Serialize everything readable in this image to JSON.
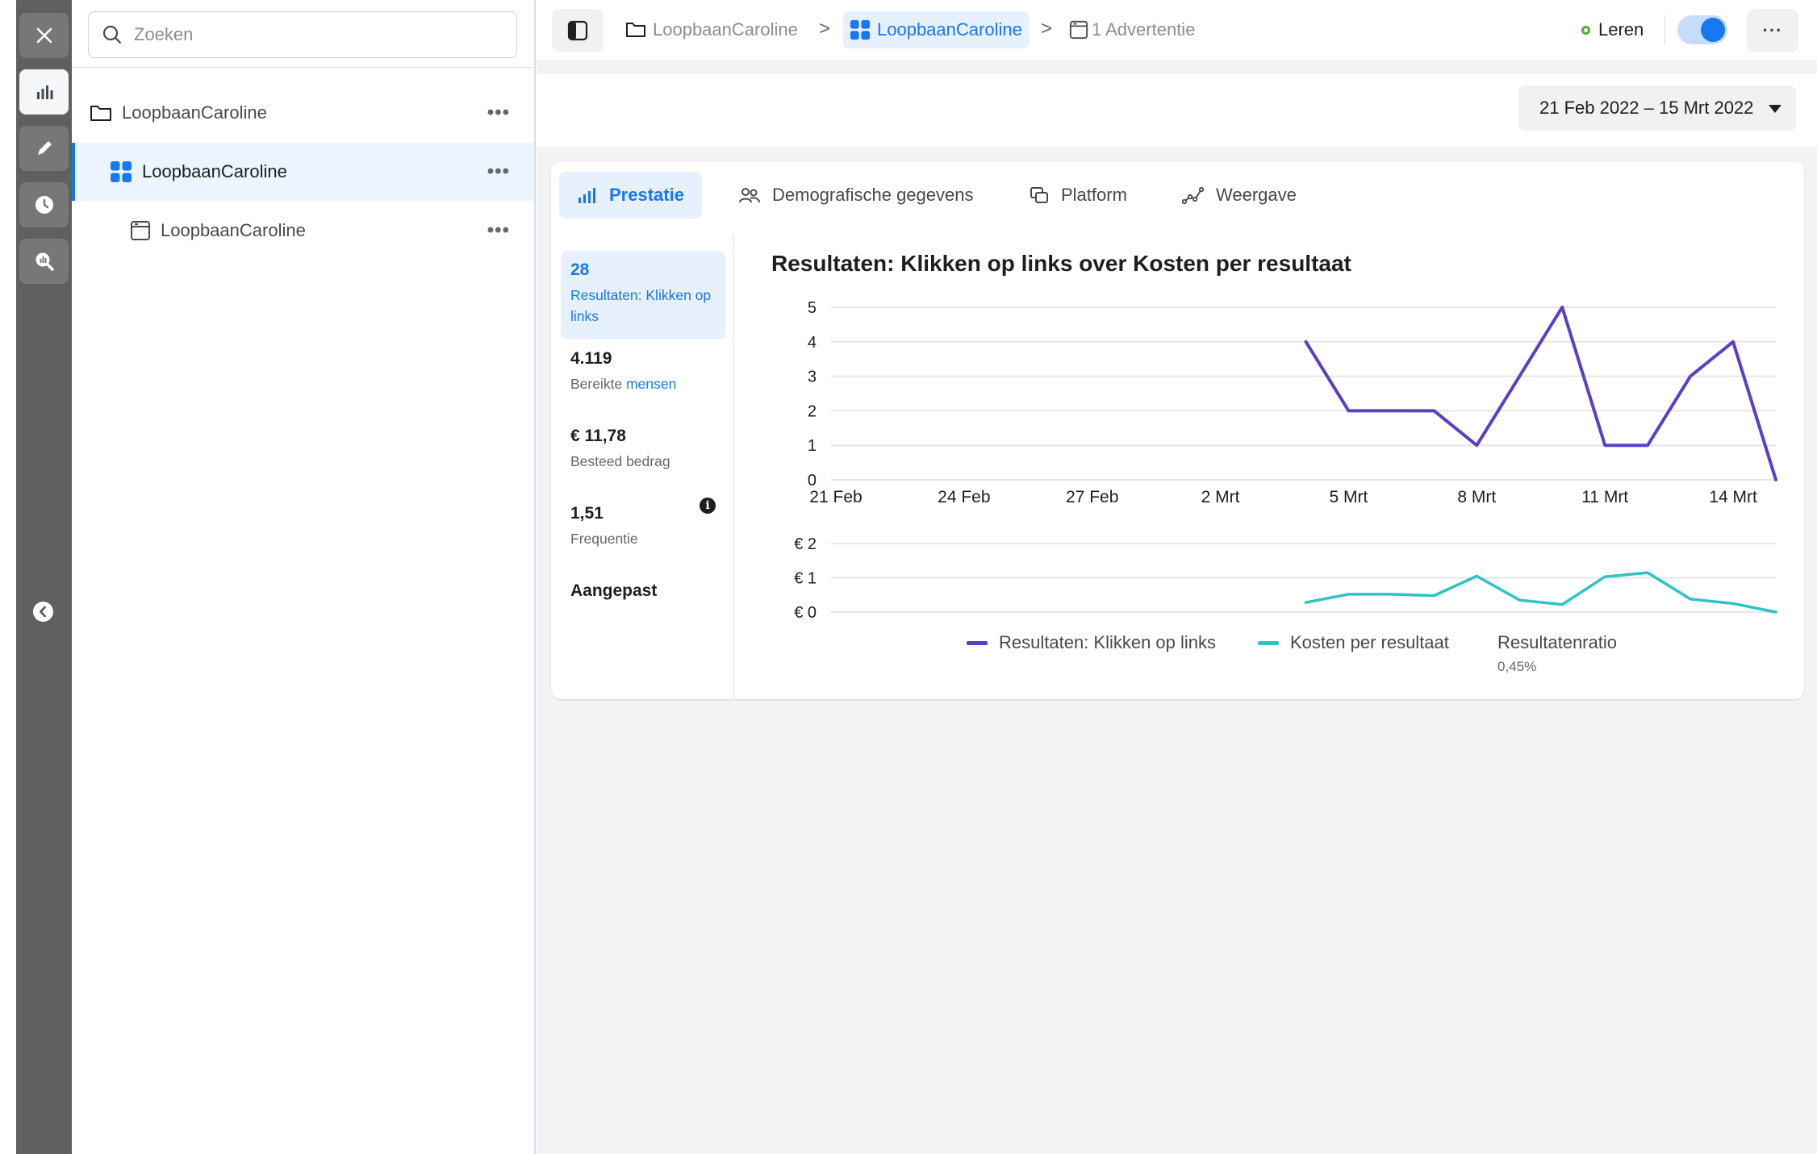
{
  "search": {
    "placeholder": "Zoeken",
    "value": ""
  },
  "tree": [
    {
      "label": "LoopbaanCaroline",
      "icon": "folder-icon",
      "more": "•••"
    },
    {
      "label": "LoopbaanCaroline",
      "icon": "adset-grid-icon",
      "more": "•••",
      "selected": true
    },
    {
      "label": "LoopbaanCaroline",
      "icon": "ad-window-icon",
      "more": "•••"
    }
  ],
  "breadcrumb": [
    {
      "label": "LoopbaanCaroline",
      "icon": "folder-icon"
    },
    {
      "label": "LoopbaanCaroline",
      "icon": "adset-grid-icon",
      "current": true
    },
    {
      "label": "1 Advertentie",
      "icon": "ad-window-icon"
    }
  ],
  "crumb_sep": ">",
  "status": {
    "label": "Leren",
    "color": "#42b72a"
  },
  "toggle": {
    "on": true
  },
  "more_label": "···",
  "date_range": "21 Feb 2022 – 15 Mrt 2022",
  "tabs": [
    {
      "label": "Prestatie",
      "icon": "bar-chart-icon",
      "active": true
    },
    {
      "label": "Demografische gegevens",
      "icon": "people-icon"
    },
    {
      "label": "Platform",
      "icon": "platform-icon"
    },
    {
      "label": "Weergave",
      "icon": "placement-icon"
    }
  ],
  "metrics": [
    {
      "value": "28",
      "label": "Resultaten: Klikken op links",
      "active": true
    },
    {
      "value": "4.119",
      "label_a": "Bereikte ",
      "label_b": "mensen"
    },
    {
      "value": "€ 11,78",
      "label": "Besteed bedrag"
    },
    {
      "value": "1,51",
      "label": "Frequentie",
      "info": "i"
    },
    {
      "value": "Aangepast"
    }
  ],
  "chart_data": {
    "type": "line",
    "title": "Resultaten: Klikken op links over Kosten per resultaat",
    "x": [
      "21 Feb",
      "22 Feb",
      "23 Feb",
      "24 Feb",
      "25 Feb",
      "26 Feb",
      "27 Feb",
      "28 Feb",
      "1 Mrt",
      "2 Mrt",
      "3 Mrt",
      "4 Mrt",
      "5 Mrt",
      "6 Mrt",
      "7 Mrt",
      "8 Mrt",
      "9 Mrt",
      "10 Mrt",
      "11 Mrt",
      "12 Mrt",
      "13 Mrt",
      "14 Mrt",
      "15 Mrt"
    ],
    "x_tick_labels": [
      "21 Feb",
      "24 Feb",
      "27 Feb",
      "2 Mrt",
      "5 Mrt",
      "8 Mrt",
      "11 Mrt",
      "14 Mrt"
    ],
    "panels": [
      {
        "series": [
          {
            "name": "Resultaten: Klikken op links",
            "color": "#5b3fc4",
            "values": [
              null,
              null,
              null,
              null,
              null,
              null,
              null,
              null,
              null,
              null,
              null,
              4,
              2,
              2,
              2,
              1,
              3,
              5,
              1,
              1,
              3,
              4,
              0
            ]
          }
        ],
        "ylim": [
          0,
          5
        ],
        "yticks": [
          "0",
          "1",
          "2",
          "3",
          "4",
          "5"
        ]
      },
      {
        "series": [
          {
            "name": "Kosten per resultaat",
            "color": "#2ec4c4",
            "values": [
              null,
              null,
              null,
              null,
              null,
              null,
              null,
              null,
              null,
              null,
              null,
              0.28,
              0.52,
              0.52,
              0.48,
              1.05,
              0.35,
              0.22,
              1.03,
              1.15,
              0.38,
              0.25,
              0.0
            ]
          }
        ],
        "ylim": [
          0,
          2
        ],
        "yticks": [
          "€ 0",
          "€ 1",
          "€ 2"
        ]
      }
    ],
    "legend": [
      {
        "name": "Resultaten: Klikken op links",
        "color": "#5b3fc4"
      },
      {
        "name": "Kosten per resultaat",
        "color": "#2ec4c4"
      }
    ],
    "ratio": {
      "label": "Resultatenratio",
      "value": "0,45%"
    },
    "grid": true
  }
}
